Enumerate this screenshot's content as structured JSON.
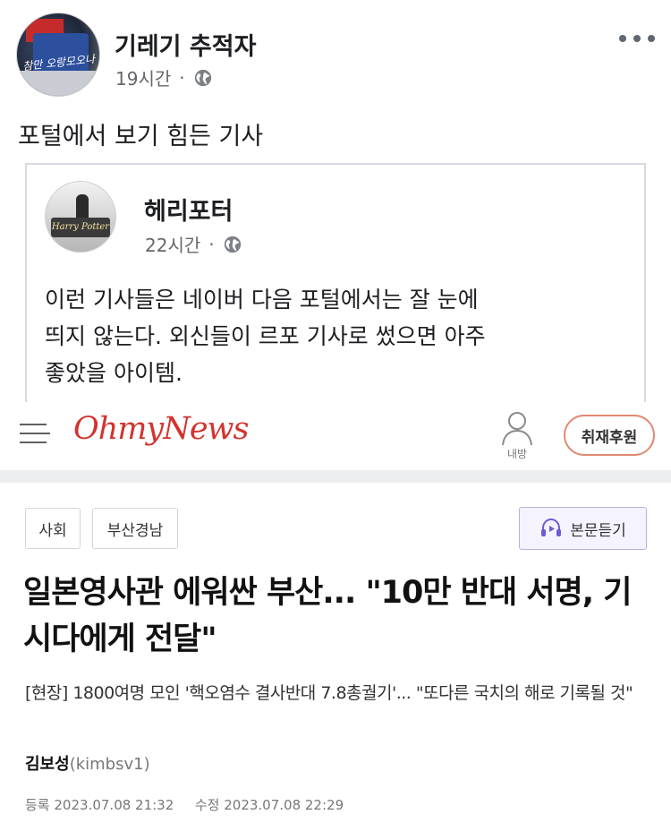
{
  "outer_post": {
    "page_name": "기레기 추적자",
    "time": "19시간",
    "dot": "·",
    "text": "포털에서 보기 힘든 기사",
    "avatar_caption": "참만 오랑모오나"
  },
  "shared_post": {
    "page_name": "헤리포터",
    "time": "22시간",
    "dot": "·",
    "avatar_caption": "Harry Potter",
    "text_lines": [
      "이런 기사들은 네이버 다음 포털에서는 잘 눈에",
      "띄지 않는다. 외신들이 르포 기사로 썼으면 아주",
      "좋았을 아이템."
    ]
  },
  "news": {
    "logo": "OhmyNews",
    "mypage_label": "내방",
    "sponsor_button": "취재후원",
    "tags": [
      "사회",
      "부산경남"
    ],
    "listen_button": "본문듣기",
    "headline": "일본영사관 에워싼 부산... \"10만 반대 서명, 기시다에게 전달\"",
    "subhead": "[현장] 1800여명 모인 '핵오염수 결사반대 7.8총궐기'... \"또다른 국치의 해로 기록될 것\"",
    "author_name": "김보성",
    "author_id": "(kimbsv1)",
    "registered_label": "등록",
    "registered": "2023.07.08 21:32",
    "modified_label": "수정",
    "modified": "2023.07.08 22:29"
  },
  "colors": {
    "brand_red": "#d3332e",
    "meta_gray": "#65676b",
    "sponsor_border": "#e08a72",
    "listen_border": "#b9b1e2"
  },
  "icons": [
    "globe-icon",
    "more-options-icon",
    "hamburger-menu-icon",
    "person-icon",
    "headphones-play-icon"
  ]
}
